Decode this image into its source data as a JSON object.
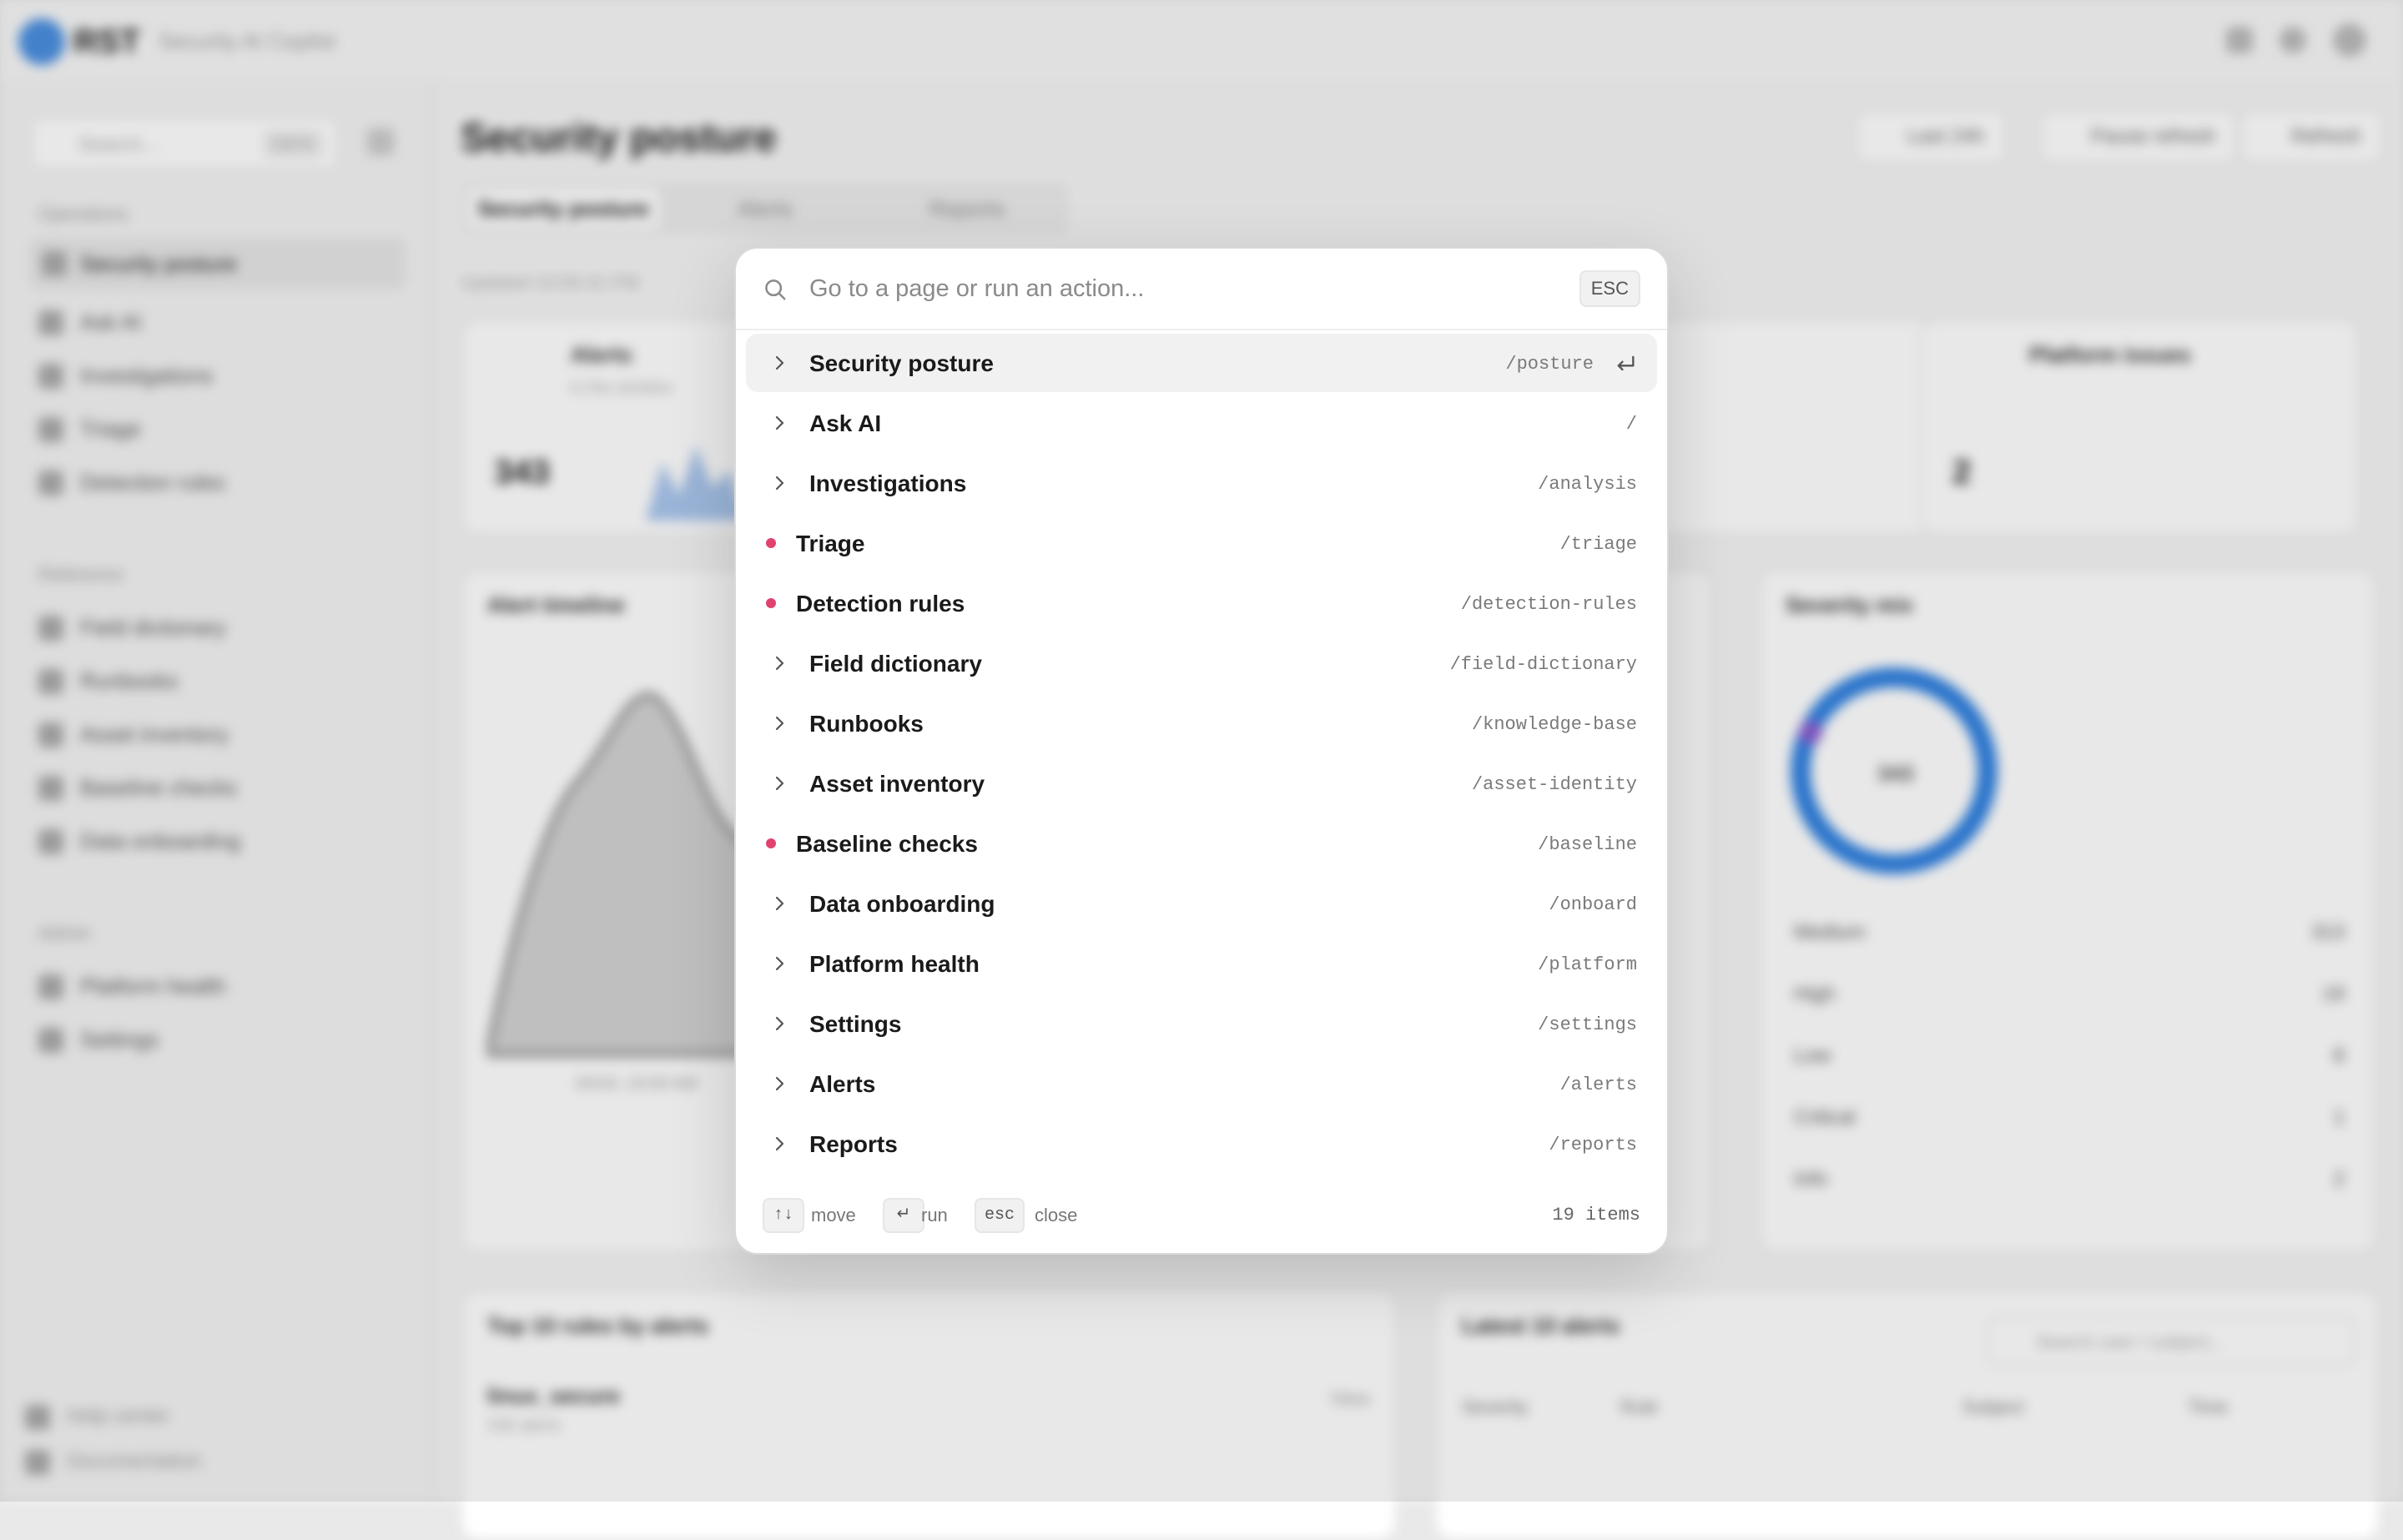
{
  "app": {
    "brand": "RST",
    "subtitle": "Security AI Copilot"
  },
  "sidebar": {
    "search_placeholder": "Search...",
    "search_shortcut": "Ctrl K",
    "sections": [
      {
        "title": "Operations",
        "items": [
          "Security posture",
          "Ask AI",
          "Investigations",
          "Triage",
          "Detection rules"
        ]
      },
      {
        "title": "Reference",
        "items": [
          "Field dictionary",
          "Runbooks",
          "Asset inventory",
          "Baseline checks",
          "Data onboarding"
        ]
      },
      {
        "title": "Admin",
        "items": [
          "Platform health",
          "Settings"
        ]
      }
    ],
    "footer_items": [
      "Help center",
      "Documentation"
    ]
  },
  "main": {
    "title": "Security posture",
    "header_buttons": [
      "Last 24h",
      "Pause refresh",
      "Refresh"
    ],
    "tabs": [
      "Security posture",
      "Alerts",
      "Reports"
    ],
    "updated": "Updated 10:55:41 PM",
    "cards": {
      "alerts": {
        "title": "Alerts",
        "subtitle": "in the window",
        "value": "343"
      },
      "platform": {
        "title": "Platform issues",
        "value": "2"
      }
    },
    "panels": {
      "timeline_title": "Alert timeline",
      "timeline_xlabel": "04/16, 10:00 AM",
      "severity_title": "Severity mix",
      "severity_center": "343",
      "severity_legend": [
        {
          "name": "Medium",
          "count": "313"
        },
        {
          "name": "High",
          "count": "19"
        },
        {
          "name": "Low",
          "count": "8"
        },
        {
          "name": "Critical",
          "count": "1"
        },
        {
          "name": "Info",
          "count": "2"
        }
      ],
      "top_rules_title": "Top 10 rules by alerts",
      "top_rule_name": "linux_secure",
      "top_rule_sub": "336 alerts",
      "top_rule_action": "View",
      "latest_title": "Latest 10 alerts",
      "latest_search_placeholder": "Search user / subject...",
      "latest_columns": [
        "Severity",
        "Rule",
        "Subject",
        "Time"
      ]
    }
  },
  "palette": {
    "search_placeholder": "Go to a page or run an action...",
    "esc_label": "ESC",
    "items": [
      {
        "label": "Security posture",
        "path": "/posture",
        "marker": "chevron",
        "selected": true
      },
      {
        "label": "Ask AI",
        "path": "/",
        "marker": "chevron"
      },
      {
        "label": "Investigations",
        "path": "/analysis",
        "marker": "chevron"
      },
      {
        "label": "Triage",
        "path": "/triage",
        "marker": "dot"
      },
      {
        "label": "Detection rules",
        "path": "/detection-rules",
        "marker": "dot"
      },
      {
        "label": "Field dictionary",
        "path": "/field-dictionary",
        "marker": "chevron"
      },
      {
        "label": "Runbooks",
        "path": "/knowledge-base",
        "marker": "chevron"
      },
      {
        "label": "Asset inventory",
        "path": "/asset-identity",
        "marker": "chevron"
      },
      {
        "label": "Baseline checks",
        "path": "/baseline",
        "marker": "dot"
      },
      {
        "label": "Data onboarding",
        "path": "/onboard",
        "marker": "chevron"
      },
      {
        "label": "Platform health",
        "path": "/platform",
        "marker": "chevron"
      },
      {
        "label": "Settings",
        "path": "/settings",
        "marker": "chevron"
      },
      {
        "label": "Alerts",
        "path": "/alerts",
        "marker": "chevron"
      },
      {
        "label": "Reports",
        "path": "/reports",
        "marker": "chevron"
      }
    ],
    "footer": {
      "move_key": "↑↓",
      "move_label": "move",
      "run_key": "↵",
      "run_label": "run",
      "close_key": "esc",
      "close_label": "close",
      "count": "19 items"
    }
  },
  "colors": {
    "accent": "#2f80e0",
    "dot": "#e0436e",
    "selected_row": "#f1f1f1"
  }
}
